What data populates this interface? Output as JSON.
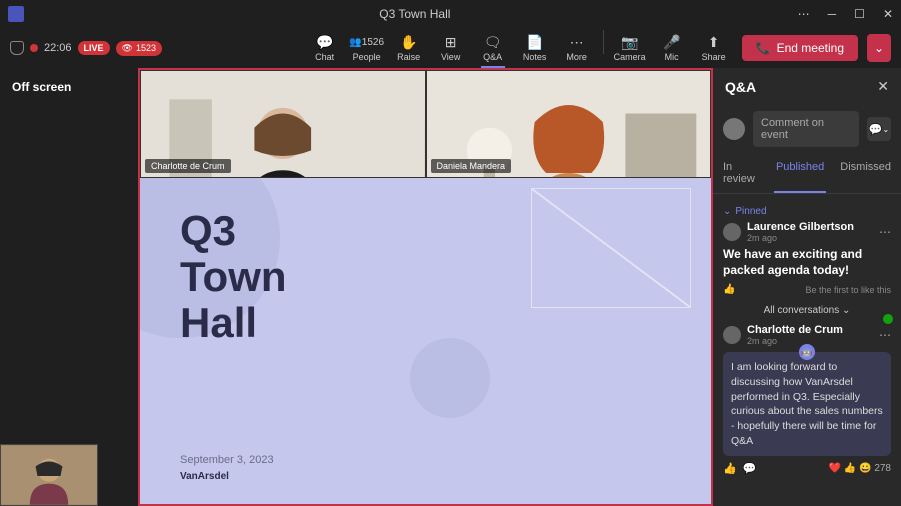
{
  "window": {
    "title": "Q3 Town Hall"
  },
  "status": {
    "time": "22:06",
    "live": "LIVE",
    "viewers": "1523"
  },
  "toolbar": {
    "chat": "Chat",
    "people_count": "1526",
    "people": "People",
    "raise": "Raise",
    "view": "View",
    "qa": "Q&A",
    "notes": "Notes",
    "more": "More",
    "camera": "Camera",
    "mic": "Mic",
    "share": "Share",
    "end": "End meeting"
  },
  "stage": {
    "off_screen": "Off screen",
    "presenter1": "Charlotte de Crum",
    "presenter2": "Daniela Mandera",
    "slide_title_l1": "Q3",
    "slide_title_l2": "Town",
    "slide_title_l3": "Hall",
    "slide_date": "September 3, 2023",
    "slide_brand": "VanArsdel"
  },
  "qa": {
    "title": "Q&A",
    "comment_placeholder": "Comment on event",
    "tabs": {
      "review": "In review",
      "published": "Published",
      "dismissed": "Dismissed"
    },
    "pinned": "Pinned",
    "item1": {
      "author": "Laurence Gilbertson",
      "time": "2m ago",
      "text": "We have an exciting and packed agenda today!",
      "like_prompt": "Be the first to like this"
    },
    "all_conv": "All conversations",
    "item2": {
      "author": "Charlotte de Crum",
      "time": "2m ago",
      "reply": "I am looking forward to discussing how VanArsdel performed in Q3. Especially curious about the sales numbers - hopefully there will be time for Q&A",
      "count": "278"
    }
  }
}
